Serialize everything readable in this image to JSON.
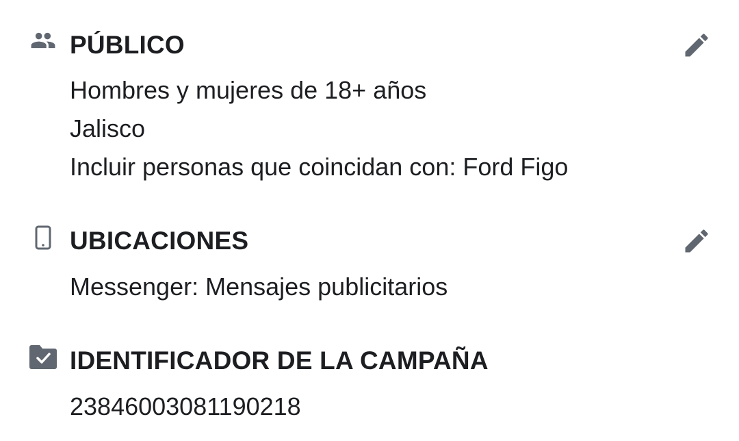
{
  "colors": {
    "text": "#1c1e21",
    "icon": "#606770"
  },
  "sections": [
    {
      "icon": "people-icon",
      "title": "PÚBLICO",
      "editable": true,
      "lines": [
        "Hombres y mujeres de 18+ años",
        "Jalisco",
        "Incluir personas que coincidan con: Ford Figo"
      ]
    },
    {
      "icon": "phone-icon",
      "title": "UBICACIONES",
      "editable": true,
      "lines": [
        "Messenger: Mensajes publicitarios"
      ]
    },
    {
      "icon": "folder-check-icon",
      "title": "IDENTIFICADOR DE LA CAMPAÑA",
      "editable": false,
      "lines": [
        "23846003081190218"
      ]
    }
  ]
}
